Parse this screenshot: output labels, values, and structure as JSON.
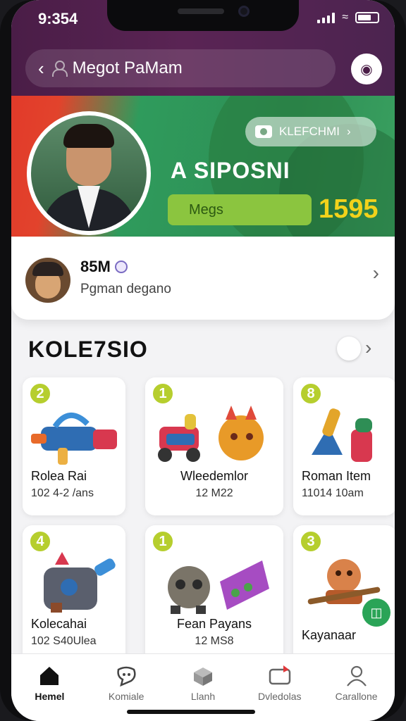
{
  "status_bar": {
    "time": "9:354"
  },
  "header": {
    "search_text": "Megot PaMam"
  },
  "hero": {
    "share_label": "KLEFCHMI",
    "name": "A SIPOSNI",
    "level_label": "Megs",
    "points": "1595"
  },
  "profile": {
    "id": "85M",
    "subtitle": "Pgman degano"
  },
  "section": {
    "title": "KOLE7SIO"
  },
  "items": [
    {
      "badge": "2",
      "title": "Rolea Rai",
      "sub": "102 4-2 /ans"
    },
    {
      "badge": "1",
      "title": "Wleedemlor",
      "sub": "12 M22"
    },
    {
      "badge": "8",
      "title": "Roman Item",
      "sub": "11014 10am"
    },
    {
      "badge": "4",
      "title": "Kolecahai",
      "sub": "102 S40Ulea"
    },
    {
      "badge": "1",
      "title": "Fean Payans",
      "sub": "12 MS8"
    },
    {
      "badge": "3",
      "title": "Kayanaar",
      "sub": ""
    }
  ],
  "nav": [
    {
      "label": "Hemel",
      "icon": "home-icon"
    },
    {
      "label": "Komiale",
      "icon": "chat-icon"
    },
    {
      "label": "Llanh",
      "icon": "box-icon"
    },
    {
      "label": "Dvledolas",
      "icon": "tv-icon"
    },
    {
      "label": "Carallone",
      "icon": "profile-icon"
    }
  ],
  "colors": {
    "accent_green": "#2e8e55",
    "badge": "#b6ce2e",
    "points": "#f2d21b",
    "header": "#4a1d47"
  }
}
